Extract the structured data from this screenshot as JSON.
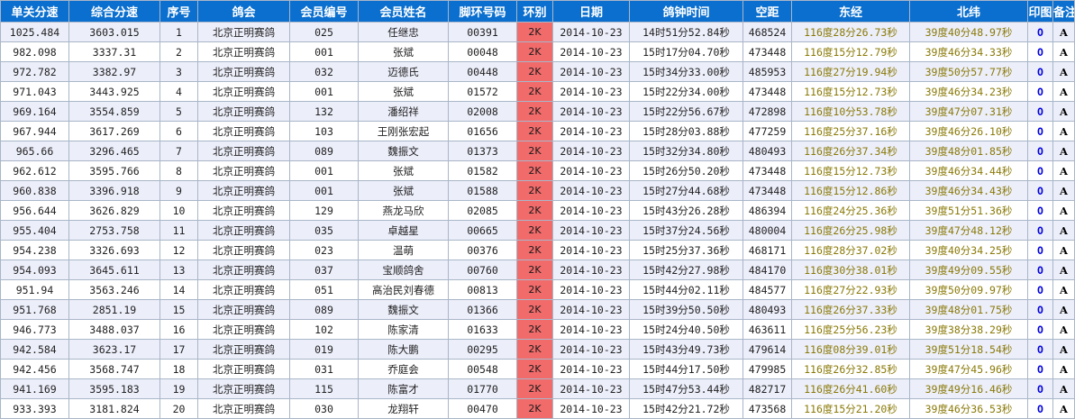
{
  "headers": [
    "单关分速",
    "综合分速",
    "序号",
    "鸽会",
    "会员编号",
    "会员姓名",
    "脚环号码",
    "环别",
    "日期",
    "鸽钟时间",
    "空距",
    "东经",
    "北纬",
    "印图",
    "备注"
  ],
  "rows": [
    {
      "speed": "1025.484",
      "combined": "3603.015",
      "rank": "1",
      "club": "北京正明赛鸽",
      "member_no": "025",
      "name": "任继忠",
      "ring_no": "00391",
      "ring_type": "2K",
      "date": "2014-10-23",
      "clock": "14时51分52.84秒",
      "distance": "468524",
      "lng": "116度28分26.73秒",
      "lat": "39度40分48.97秒",
      "print": "O",
      "note": "A"
    },
    {
      "speed": "982.098",
      "combined": "3337.31",
      "rank": "2",
      "club": "北京正明赛鸽",
      "member_no": "001",
      "name": "张斌",
      "ring_no": "00048",
      "ring_type": "2K",
      "date": "2014-10-23",
      "clock": "15时17分04.70秒",
      "distance": "473448",
      "lng": "116度15分12.79秒",
      "lat": "39度46分34.33秒",
      "print": "O",
      "note": "A"
    },
    {
      "speed": "972.782",
      "combined": "3382.97",
      "rank": "3",
      "club": "北京正明赛鸽",
      "member_no": "032",
      "name": "迈德氏",
      "ring_no": "00448",
      "ring_type": "2K",
      "date": "2014-10-23",
      "clock": "15时34分33.00秒",
      "distance": "485953",
      "lng": "116度27分19.94秒",
      "lat": "39度50分57.77秒",
      "print": "O",
      "note": "A"
    },
    {
      "speed": "971.043",
      "combined": "3443.925",
      "rank": "4",
      "club": "北京正明赛鸽",
      "member_no": "001",
      "name": "张斌",
      "ring_no": "01572",
      "ring_type": "2K",
      "date": "2014-10-23",
      "clock": "15时22分34.00秒",
      "distance": "473448",
      "lng": "116度15分12.73秒",
      "lat": "39度46分34.23秒",
      "print": "O",
      "note": "A"
    },
    {
      "speed": "969.164",
      "combined": "3554.859",
      "rank": "5",
      "club": "北京正明赛鸽",
      "member_no": "132",
      "name": "潘绍祥",
      "ring_no": "02008",
      "ring_type": "2K",
      "date": "2014-10-23",
      "clock": "15时22分56.67秒",
      "distance": "472898",
      "lng": "116度10分53.78秒",
      "lat": "39度47分07.31秒",
      "print": "O",
      "note": "A"
    },
    {
      "speed": "967.944",
      "combined": "3617.269",
      "rank": "6",
      "club": "北京正明赛鸽",
      "member_no": "103",
      "name": "王刚张宏起",
      "ring_no": "01656",
      "ring_type": "2K",
      "date": "2014-10-23",
      "clock": "15时28分03.88秒",
      "distance": "477259",
      "lng": "116度25分37.16秒",
      "lat": "39度46分26.10秒",
      "print": "O",
      "note": "A"
    },
    {
      "speed": "965.66",
      "combined": "3296.465",
      "rank": "7",
      "club": "北京正明赛鸽",
      "member_no": "089",
      "name": "魏振文",
      "ring_no": "01373",
      "ring_type": "2K",
      "date": "2014-10-23",
      "clock": "15时32分34.80秒",
      "distance": "480493",
      "lng": "116度26分37.34秒",
      "lat": "39度48分01.85秒",
      "print": "O",
      "note": "A"
    },
    {
      "speed": "962.612",
      "combined": "3595.766",
      "rank": "8",
      "club": "北京正明赛鸽",
      "member_no": "001",
      "name": "张斌",
      "ring_no": "01582",
      "ring_type": "2K",
      "date": "2014-10-23",
      "clock": "15时26分50.20秒",
      "distance": "473448",
      "lng": "116度15分12.73秒",
      "lat": "39度46分34.44秒",
      "print": "O",
      "note": "A"
    },
    {
      "speed": "960.838",
      "combined": "3396.918",
      "rank": "9",
      "club": "北京正明赛鸽",
      "member_no": "001",
      "name": "张斌",
      "ring_no": "01588",
      "ring_type": "2K",
      "date": "2014-10-23",
      "clock": "15时27分44.68秒",
      "distance": "473448",
      "lng": "116度15分12.86秒",
      "lat": "39度46分34.43秒",
      "print": "O",
      "note": "A"
    },
    {
      "speed": "956.644",
      "combined": "3626.829",
      "rank": "10",
      "club": "北京正明赛鸽",
      "member_no": "129",
      "name": "燕龙马欣",
      "ring_no": "02085",
      "ring_type": "2K",
      "date": "2014-10-23",
      "clock": "15时43分26.28秒",
      "distance": "486394",
      "lng": "116度24分25.36秒",
      "lat": "39度51分51.36秒",
      "print": "O",
      "note": "A"
    },
    {
      "speed": "955.404",
      "combined": "2753.758",
      "rank": "11",
      "club": "北京正明赛鸽",
      "member_no": "035",
      "name": "卓越星",
      "ring_no": "00665",
      "ring_type": "2K",
      "date": "2014-10-23",
      "clock": "15时37分24.56秒",
      "distance": "480004",
      "lng": "116度26分25.98秒",
      "lat": "39度47分48.12秒",
      "print": "O",
      "note": "A"
    },
    {
      "speed": "954.238",
      "combined": "3326.693",
      "rank": "12",
      "club": "北京正明赛鸽",
      "member_no": "023",
      "name": "温萌",
      "ring_no": "00376",
      "ring_type": "2K",
      "date": "2014-10-23",
      "clock": "15时25分37.36秒",
      "distance": "468171",
      "lng": "116度28分37.02秒",
      "lat": "39度40分34.25秒",
      "print": "O",
      "note": "A"
    },
    {
      "speed": "954.093",
      "combined": "3645.611",
      "rank": "13",
      "club": "北京正明赛鸽",
      "member_no": "037",
      "name": "宝顺鸽舍",
      "ring_no": "00760",
      "ring_type": "2K",
      "date": "2014-10-23",
      "clock": "15时42分27.98秒",
      "distance": "484170",
      "lng": "116度30分38.01秒",
      "lat": "39度49分09.55秒",
      "print": "O",
      "note": "A"
    },
    {
      "speed": "951.94",
      "combined": "3563.246",
      "rank": "14",
      "club": "北京正明赛鸽",
      "member_no": "051",
      "name": "高治民刘春德",
      "ring_no": "00813",
      "ring_type": "2K",
      "date": "2014-10-23",
      "clock": "15时44分02.11秒",
      "distance": "484577",
      "lng": "116度27分22.93秒",
      "lat": "39度50分09.97秒",
      "print": "O",
      "note": "A"
    },
    {
      "speed": "951.768",
      "combined": "2851.19",
      "rank": "15",
      "club": "北京正明赛鸽",
      "member_no": "089",
      "name": "魏振文",
      "ring_no": "01366",
      "ring_type": "2K",
      "date": "2014-10-23",
      "clock": "15时39分50.50秒",
      "distance": "480493",
      "lng": "116度26分37.33秒",
      "lat": "39度48分01.75秒",
      "print": "O",
      "note": "A"
    },
    {
      "speed": "946.773",
      "combined": "3488.037",
      "rank": "16",
      "club": "北京正明赛鸽",
      "member_no": "102",
      "name": "陈家清",
      "ring_no": "01633",
      "ring_type": "2K",
      "date": "2014-10-23",
      "clock": "15时24分40.50秒",
      "distance": "463611",
      "lng": "116度25分56.23秒",
      "lat": "39度38分38.29秒",
      "print": "O",
      "note": "A"
    },
    {
      "speed": "942.584",
      "combined": "3623.17",
      "rank": "17",
      "club": "北京正明赛鸽",
      "member_no": "019",
      "name": "陈大鹏",
      "ring_no": "00295",
      "ring_type": "2K",
      "date": "2014-10-23",
      "clock": "15时43分49.73秒",
      "distance": "479614",
      "lng": "116度08分39.01秒",
      "lat": "39度51分18.54秒",
      "print": "O",
      "note": "A"
    },
    {
      "speed": "942.456",
      "combined": "3568.747",
      "rank": "18",
      "club": "北京正明赛鸽",
      "member_no": "031",
      "name": "乔庭会",
      "ring_no": "00548",
      "ring_type": "2K",
      "date": "2014-10-23",
      "clock": "15时44分17.50秒",
      "distance": "479985",
      "lng": "116度26分32.85秒",
      "lat": "39度47分45.96秒",
      "print": "O",
      "note": "A"
    },
    {
      "speed": "941.169",
      "combined": "3595.183",
      "rank": "19",
      "club": "北京正明赛鸽",
      "member_no": "115",
      "name": "陈富才",
      "ring_no": "01770",
      "ring_type": "2K",
      "date": "2014-10-23",
      "clock": "15时47分53.44秒",
      "distance": "482717",
      "lng": "116度26分41.60秒",
      "lat": "39度49分16.46秒",
      "print": "O",
      "note": "A"
    },
    {
      "speed": "933.393",
      "combined": "3181.824",
      "rank": "20",
      "club": "北京正明赛鸽",
      "member_no": "030",
      "name": "龙翔轩",
      "ring_no": "00470",
      "ring_type": "2K",
      "date": "2014-10-23",
      "clock": "15时42分21.72秒",
      "distance": "473568",
      "lng": "116度15分21.20秒",
      "lat": "39度46分36.53秒",
      "print": "O",
      "note": "A"
    }
  ]
}
